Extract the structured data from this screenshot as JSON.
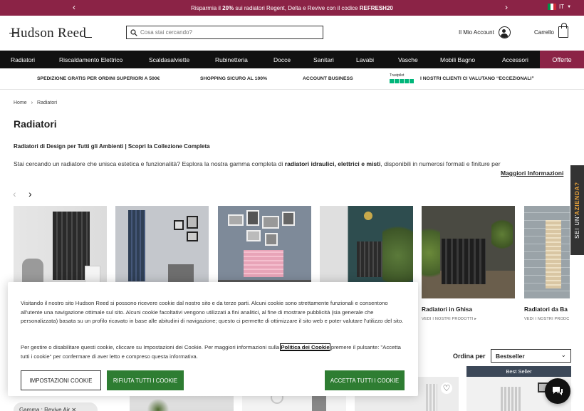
{
  "promo": {
    "prefix": "Risparmia il ",
    "percent": "20%",
    "middle": " sui radiatori Regent, Delta e Revive con il codice ",
    "code": "REFRESH20",
    "prev": "‹",
    "next": "›",
    "language": "IT",
    "colors": {
      "bg": "#8b2346"
    }
  },
  "header": {
    "logo": "Hudson Reed",
    "search_placeholder": "Cosa stai cercando?",
    "account_label": "Il Mio Account",
    "cart_label": "Carrello"
  },
  "nav": {
    "items": [
      "Radiatori",
      "Riscaldamento Elettrico",
      "Scaldasalviette",
      "Rubinetteria",
      "Docce",
      "Sanitari",
      "Lavabi",
      "Vasche",
      "Mobili Bagno",
      "Accessori"
    ],
    "offer": "Offerte"
  },
  "usp": {
    "items": [
      "SPEDIZIONE GRATIS PER ORDINI SUPERIORI A 500€",
      "SHOPPING SICURO AL 100%",
      "ACCOUNT BUSINESS"
    ],
    "trustpilot_logo": "Trustpilot",
    "trustpilot_text": "I NOSTRI CLIENTI CI VALUTANO “ECCEZIONALI”"
  },
  "breadcrumb": [
    "Home",
    "›",
    "Radiatori"
  ],
  "page": {
    "title": "Radiatori",
    "subtitle": "Radiatori di Design per Tutti gli Ambienti | Scopri la Collezione Completa",
    "intro_start": "Stai cercando un radiatore che unisca estetica e funzionalità? Esplora la nostra gamma completa di ",
    "intro_bold": "radiatori idraulici, elettrici e misti",
    "intro_end": ", disponibili in numerosi formati e finiture per",
    "more_info": "Maggiori Informazioni"
  },
  "categories": [
    {
      "label": "",
      "link": ""
    },
    {
      "label": "",
      "link": ""
    },
    {
      "label": "",
      "link": ""
    },
    {
      "label": "",
      "link": ""
    },
    {
      "label": "Radiatori in Ghisa",
      "link": "VEDI I NOSTRI PRODOTTI ▸"
    },
    {
      "label": "Radiatori da Ba",
      "link": "VEDI I NOSTRI PRODC"
    }
  ],
  "side_tab": {
    "prefix": "SEI UN'",
    "highlight": "AZIENDA?"
  },
  "sort": {
    "label": "Ordina per",
    "selected": "Bestseller"
  },
  "bestseller_badge": "Best Seller",
  "filter_chip": "Gamma : Revive Air  ✕",
  "cookie": {
    "text1": "Visitando il nostro sito Hudson Reed si possono ricevere cookie dal nostro sito e da terze parti. Alcuni cookie sono strettamente funzionali e consentono all'utente una navigazione ottimale sul sito. Alcuni cookie facoltativi vengono utilizzati a fini analitici, al fine di mostrare pubblicità (sia generale che personalizzata) basata su un profilo ricavato in base alle abitudini di navigazione; questo ci permette di ottimizzare il sito web e poter valutare l'utilizzo del sito.",
    "text2_start": "Per gestire o disabilitare questi cookie, cliccare su Impostazioni dei Cookie. Per maggiori informazioni sulla ",
    "policy_link": "Politica dei Cookie",
    "text2_end": " premere il pulsante: \"Accetta tutti i cookie\" per confermare di aver letto e compreso questa informativa.",
    "settings_button": "IMPOSTAZIONI COOKIE",
    "reject_button": "RIFIUTA TUTTI I COOKIE",
    "accept_button": "ACCETTA TUTTI I COOKIE",
    "colors": {
      "green": "#2e7d32"
    }
  }
}
